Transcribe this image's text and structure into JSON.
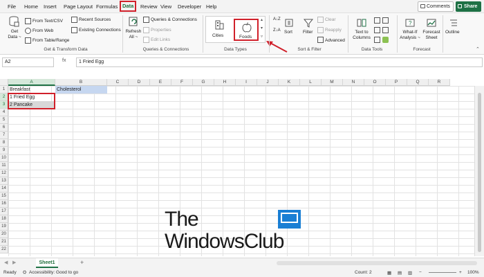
{
  "menu": {
    "tabs": [
      "File",
      "Home",
      "Insert",
      "Page Layout",
      "Formulas",
      "Data",
      "Review",
      "View",
      "Developer",
      "Help"
    ],
    "active_tab": "Data",
    "comments_label": "Comments",
    "share_label": "Share"
  },
  "ribbon": {
    "get_data_label": "Get Data ~",
    "from_text_csv": "From Text/CSV",
    "from_web": "From Web",
    "from_table_range": "From Table/Range",
    "recent_sources": "Recent Sources",
    "existing_connections": "Existing Connections",
    "group_get_transform": "Get & Transform Data",
    "refresh_all": "Refresh All ~",
    "queries_connections": "Queries & Connections",
    "properties": "Properties",
    "edit_links": "Edit Links",
    "group_queries": "Queries & Connections",
    "cities": "Cities",
    "foods": "Foods",
    "group_data_types": "Data Types",
    "sort": "Sort",
    "filter": "Filter",
    "clear": "Clear",
    "reapply": "Reapply",
    "advanced": "Advanced",
    "group_sort_filter": "Sort & Filter",
    "text_to_columns": "Text to Columns",
    "group_data_tools": "Data Tools",
    "whatif": "What-If Analysis ~",
    "forecast_sheet": "Forecast Sheet",
    "group_forecast": "Forecast",
    "outline": "Outline",
    "accent": "#1e7145",
    "highlight": "#d0202a"
  },
  "formula_bar": {
    "name_box": "A2",
    "fx": "fx",
    "content": "1 Fried Egg"
  },
  "grid": {
    "columns": [
      "A",
      "B",
      "C",
      "D",
      "E",
      "F",
      "G",
      "H",
      "I",
      "J",
      "K",
      "L",
      "M",
      "N",
      "O",
      "P",
      "Q",
      "R"
    ],
    "rows": [
      "1",
      "2",
      "3",
      "4",
      "5",
      "6",
      "7",
      "8",
      "9",
      "10",
      "11",
      "12",
      "13",
      "14",
      "15",
      "16",
      "17",
      "18",
      "19",
      "20",
      "21",
      "22"
    ],
    "a1": "Breakfast",
    "b1": "Cholesterol",
    "a2": "1 Fried Egg",
    "a3": "2 Pancake"
  },
  "sheets": {
    "active": "Sheet1",
    "add": "+"
  },
  "status": {
    "ready": "Ready",
    "accessibility": "Accessibility: Good to go",
    "count": "Count: 2",
    "zoom": "100%"
  },
  "watermark": {
    "line1": "The",
    "line2": "WindowsClub"
  }
}
